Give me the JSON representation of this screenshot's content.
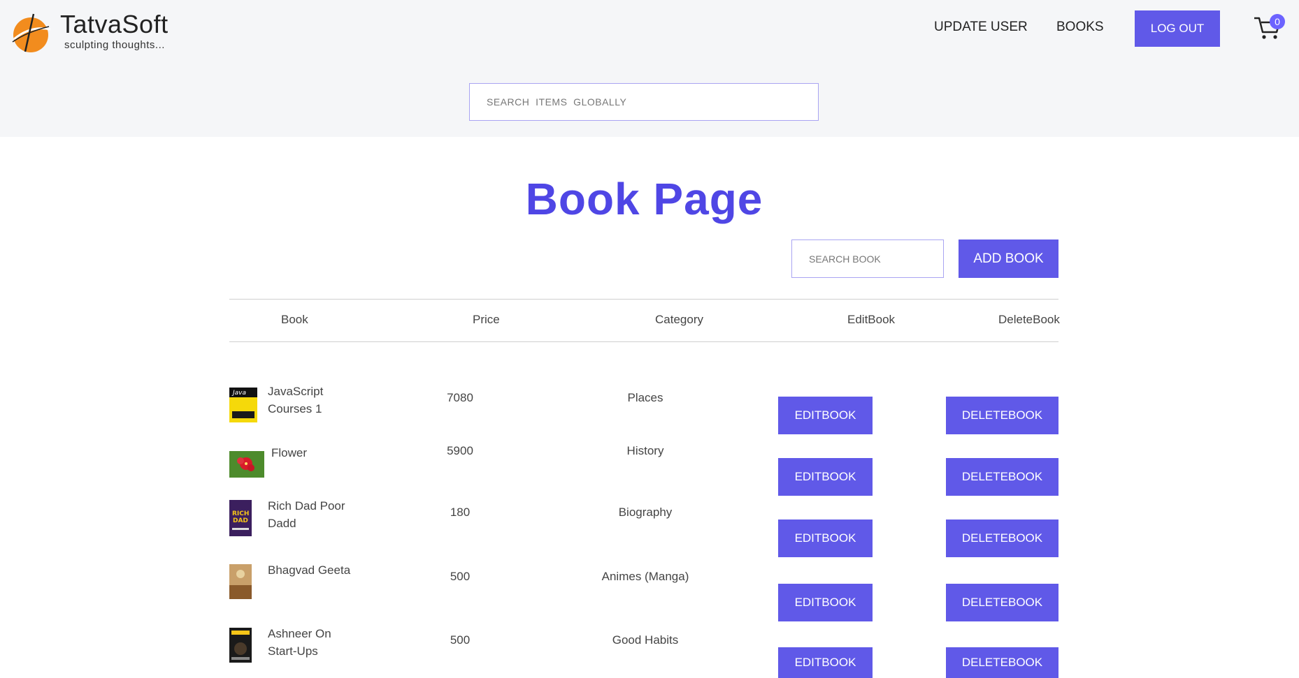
{
  "brand": {
    "name": "TatvaSoft",
    "tagline": "sculpting thoughts..."
  },
  "nav": {
    "update_user": "UPDATE USER",
    "books": "BOOKS",
    "logout": "LOG OUT",
    "cart_count": "0"
  },
  "global_search": {
    "placeholder": "SEARCH  ITEMS  GLOBALLY"
  },
  "page": {
    "title": "Book Page"
  },
  "toolbar": {
    "search_placeholder": "SEARCH BOOK",
    "add_label": "ADD BOOK"
  },
  "table": {
    "headers": [
      "Book",
      "Price",
      "Category",
      "EditBook",
      "DeleteBook"
    ],
    "rows": [
      {
        "title": "JavaScript Courses 1",
        "price": "7080",
        "category": "Places",
        "edit": "EDITBOOK",
        "delete": "DELETEBOOK"
      },
      {
        "title": "Flower",
        "price": "5900",
        "category": "History",
        "edit": "EDITBOOK",
        "delete": "DELETEBOOK"
      },
      {
        "title": "Rich Dad Poor Dadd",
        "price": "180",
        "category": "Biography",
        "edit": "EDITBOOK",
        "delete": "DELETEBOOK"
      },
      {
        "title": "Bhagvad Geeta",
        "price": "500",
        "category": "Animes (Manga)",
        "edit": "EDITBOOK",
        "delete": "DELETEBOOK"
      },
      {
        "title": "Ashneer On Start-Ups",
        "price": "500",
        "category": "Good Habits",
        "edit": "EDITBOOK",
        "delete": "DELETEBOOK"
      }
    ]
  },
  "colors": {
    "accent": "#6059e8",
    "title": "#4f46e5",
    "header_bg": "#f5f6f8"
  }
}
